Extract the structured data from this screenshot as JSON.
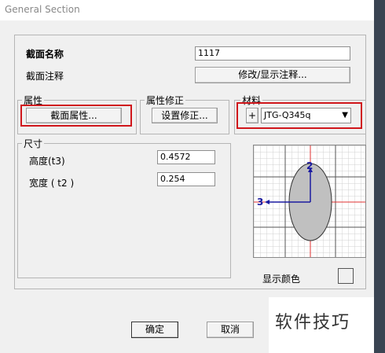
{
  "window": {
    "title": "General Section"
  },
  "section": {
    "name_label": "截面名称",
    "name_value": "1117",
    "note_label": "截面注释",
    "note_button": "修改/显示注释..."
  },
  "property": {
    "group_label": "属性",
    "button": "截面属性..."
  },
  "modifier": {
    "group_label": "属性修正",
    "button": "设置修正..."
  },
  "material": {
    "group_label": "材料",
    "add_button": "+",
    "selected": "JTG-Q345q"
  },
  "dimensions": {
    "group_label": "尺寸",
    "height_label": "高度(t3)",
    "height_value": "0.4572",
    "width_label": "宽度 ( t2 )",
    "width_value": "0.254"
  },
  "preview": {
    "axis_2_label": "2",
    "axis_3_label": "3",
    "fill_color": "#c0c0c0",
    "axis_color": "#e03030",
    "local_axis_color": "#1a1aa0"
  },
  "display_color": {
    "label": "显示颜色"
  },
  "footer": {
    "ok": "确定",
    "cancel": "取消"
  },
  "watermark": {
    "text": "软件技巧"
  }
}
